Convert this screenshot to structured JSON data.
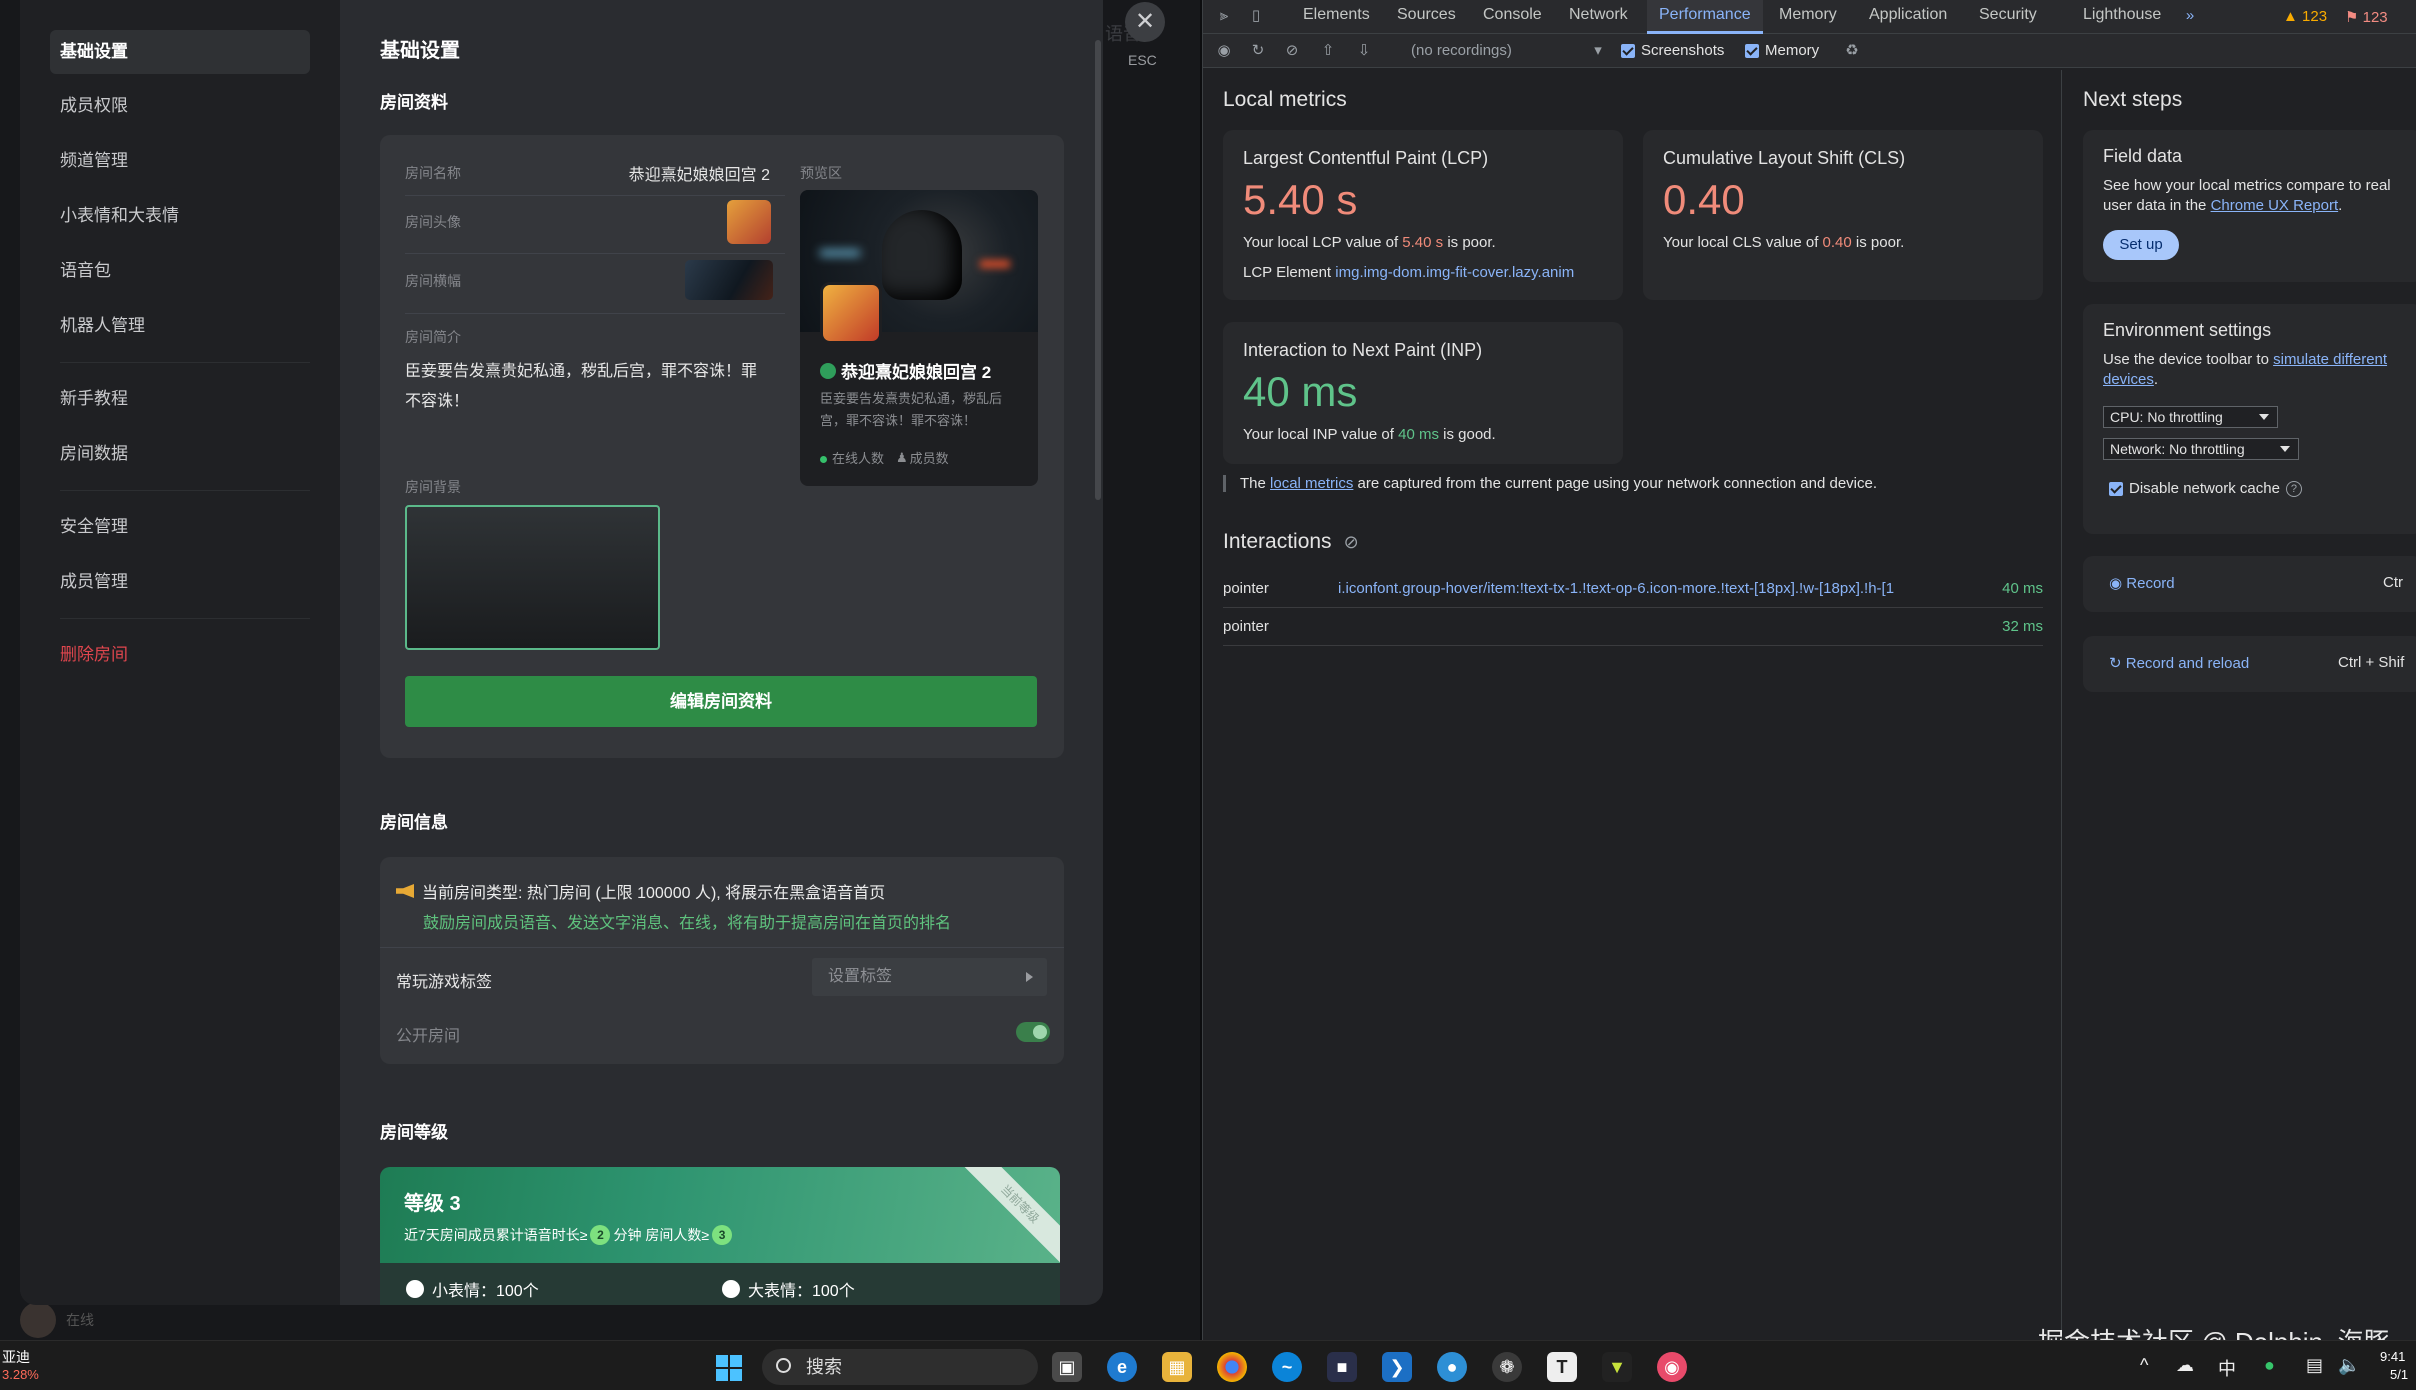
{
  "app": {
    "bg_text": "语音",
    "bottom_user": "在线"
  },
  "sidebar": {
    "items": [
      {
        "label": "基础设置"
      },
      {
        "label": "成员权限"
      },
      {
        "label": "频道管理"
      },
      {
        "label": "小表情和大表情"
      },
      {
        "label": "语音包"
      },
      {
        "label": "机器人管理"
      },
      {
        "label": "新手教程"
      },
      {
        "label": "房间数据"
      },
      {
        "label": "安全管理"
      },
      {
        "label": "成员管理"
      },
      {
        "label": "删除房间"
      }
    ]
  },
  "main": {
    "title": "基础设置",
    "profile": {
      "heading": "房间资料",
      "name_label": "房间名称",
      "name_value": "恭迎熹妃娘娘回宫 2",
      "avatar_label": "房间头像",
      "banner_label": "房间横幅",
      "intro_label": "房间简介",
      "intro_value": "臣妾要告发熹贵妃私通，秽乱后宫，罪不容诛！罪不容诛！",
      "preview_label": "预览区",
      "preview_name": "恭迎熹妃娘娘回宫 2",
      "preview_desc": "臣妾要告发熹贵妃私通，秽乱后宫，罪不容诛！罪不容诛！",
      "preview_online": "在线人数",
      "preview_members": "成员数",
      "background_label": "房间背景",
      "edit_button": "编辑房间资料"
    },
    "info": {
      "heading": "房间信息",
      "notice_line1": "当前房间类型: 热门房间 (上限 100000 人), 将展示在黑盒语音首页",
      "notice_line2": "鼓励房间成员语音、发送文字消息、在线，将有助于提高房间在首页的排名",
      "game_tag_label": "常玩游戏标签",
      "game_tag_placeholder": "设置标签",
      "public_label": "公开房间",
      "public_on": true
    },
    "level": {
      "heading": "房间等级",
      "title": "等级 3",
      "desc_prefix": "近7天房间成员累计语音时长≥",
      "desc_num1": "2",
      "desc_mid": "分钟  房间人数≥",
      "desc_num2": "3",
      "ribbon": "当前等级",
      "perk1": "小表情：100个",
      "perk2": "大表情：100个"
    },
    "close_label": "ESC"
  },
  "devtools": {
    "tabs": [
      "Elements",
      "Sources",
      "Console",
      "Network",
      "Performance",
      "Memory",
      "Application",
      "Security",
      "Lighthouse"
    ],
    "active_tab": "Performance",
    "warnings": "123",
    "errors": "123",
    "recordings_placeholder": "(no recordings)",
    "screenshots_label": "Screenshots",
    "memory_label": "Memory",
    "local_metrics": {
      "title": "Local metrics",
      "lcp": {
        "title": "Largest Contentful Paint (LCP)",
        "value": "5.40 s",
        "line_prefix": "Your local LCP value of ",
        "line_value": "5.40 s",
        "line_suffix": " is poor.",
        "element_label": "LCP Element ",
        "element_value": "img.img-dom.img-fit-cover.lazy.anim"
      },
      "cls": {
        "title": "Cumulative Layout Shift (CLS)",
        "value": "0.40",
        "line_prefix": "Your local CLS value of ",
        "line_value": "0.40",
        "line_suffix": " is poor."
      },
      "inp": {
        "title": "Interaction to Next Paint (INP)",
        "value": "40 ms",
        "line_prefix": "Your local INP value of ",
        "line_value": "40 ms",
        "line_suffix": " is good."
      },
      "footnote_prefix": "The ",
      "footnote_link": "local metrics",
      "footnote_suffix": " are captured from the current page using your network connection and device."
    },
    "interactions": {
      "title": "Interactions",
      "rows": [
        {
          "type": "pointer",
          "selector": "i.iconfont.group-hover/item:!text-tx-1.!text-op-6.icon-more.!text-[18px].!w-[18px].!h-[1",
          "time": "40 ms"
        },
        {
          "type": "pointer",
          "selector": "",
          "time": "32 ms"
        }
      ]
    },
    "next_steps": {
      "title": "Next steps",
      "field_title": "Field data",
      "field_text_prefix": "See how your local metrics compare to real user data in the ",
      "field_link": "Chrome UX Report",
      "field_text_suffix": ".",
      "setup_button": "Set up",
      "env_title": "Environment settings",
      "env_text_prefix": "Use the device toolbar to ",
      "env_link": "simulate different devices",
      "env_text_suffix": ".",
      "cpu_select": "CPU: No throttling",
      "network_select": "Network: No throttling",
      "disable_cache": "Disable network cache",
      "record": "Record",
      "record_shortcut": "Ctr",
      "record_reload": "Record and reload",
      "record_reload_shortcut": "Ctrl + Shif"
    }
  },
  "watermark": "掘金技术社区 @ Dolphin_海豚",
  "taskbar": {
    "left_line1": "亚迪",
    "left_line2": "3.28%",
    "search_placeholder": "搜索",
    "ime": "中",
    "time": "9:41",
    "date": "5/1"
  }
}
